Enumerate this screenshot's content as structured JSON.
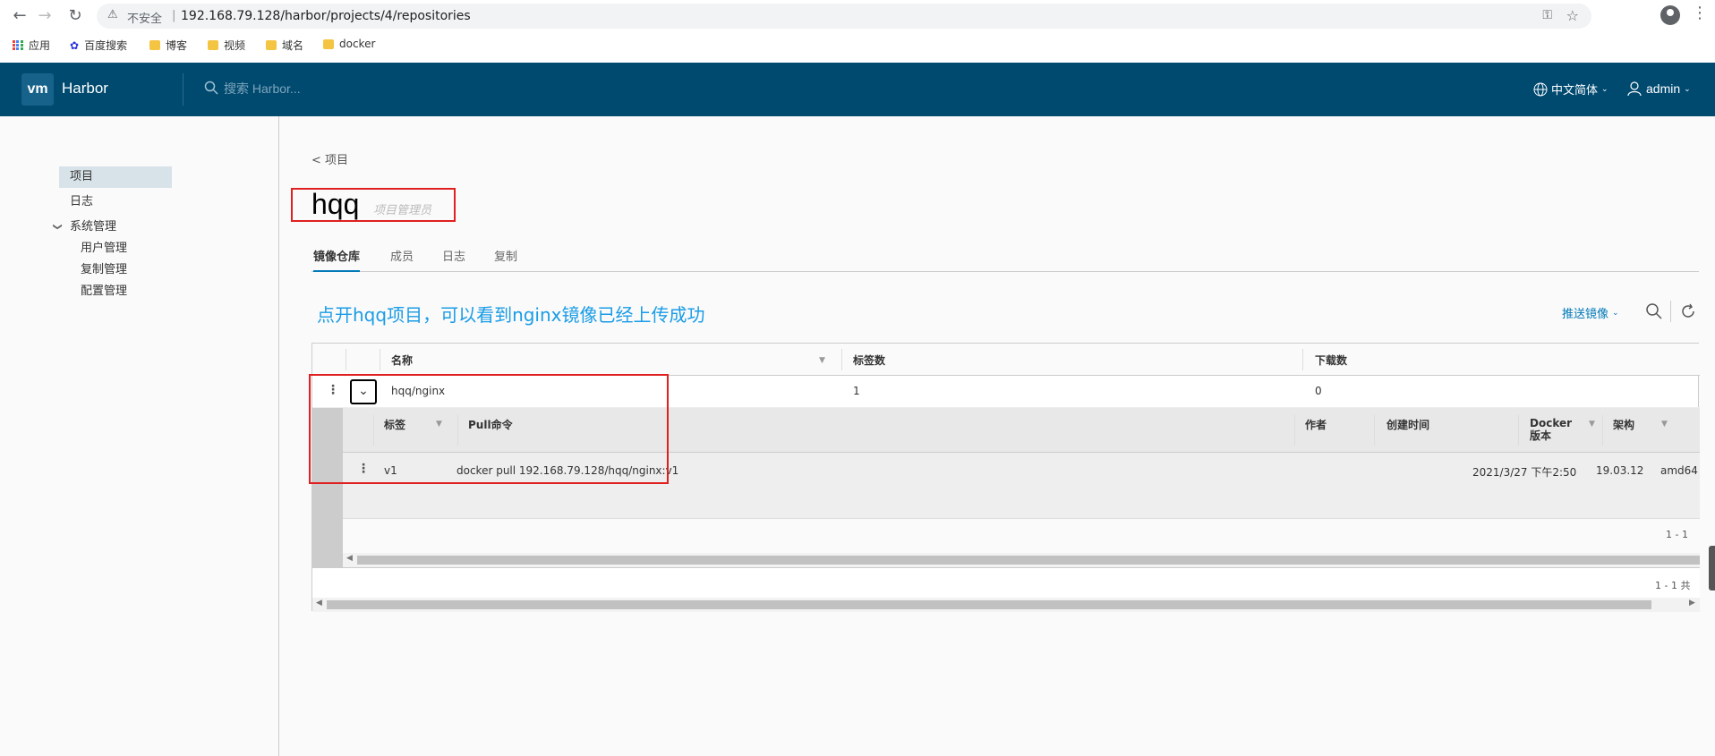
{
  "browser": {
    "insecure_label": "不安全",
    "url": "192.168.79.128/harbor/projects/4/repositories",
    "bookmarks": [
      {
        "label": "应用",
        "icon": "apps-grid-icon"
      },
      {
        "label": "百度搜索",
        "icon": "baidu-paw-icon"
      },
      {
        "label": "博客",
        "icon": "folder-icon"
      },
      {
        "label": "视频",
        "icon": "folder-icon"
      },
      {
        "label": "域名",
        "icon": "folder-icon"
      },
      {
        "label": "docker",
        "icon": "folder-icon"
      }
    ]
  },
  "header": {
    "logo": "vm",
    "app_name": "Harbor",
    "search_placeholder": "搜索 Harbor...",
    "language": "中文简体",
    "user": "admin"
  },
  "sidebar": {
    "items": [
      {
        "label": "项目",
        "active": true
      },
      {
        "label": "日志"
      },
      {
        "label": "系统管理"
      },
      {
        "label": "用户管理"
      },
      {
        "label": "复制管理"
      },
      {
        "label": "配置管理"
      }
    ]
  },
  "main": {
    "breadcrumb": "< 项目",
    "project_name": "hqq",
    "role": "项目管理员",
    "tabs": [
      {
        "label": "镜像仓库",
        "active": true
      },
      {
        "label": "成员"
      },
      {
        "label": "日志"
      },
      {
        "label": "复制"
      }
    ],
    "annotation": "点开hqq项目，可以看到nginx镜像已经上传成功",
    "push_image_label": "推送镜像",
    "columns": [
      "名称",
      "标签数",
      "下载数"
    ],
    "rows": [
      {
        "name": "hqq/nginx",
        "tags": "1",
        "pulls": "0"
      }
    ],
    "tag_columns": [
      "标签",
      "Pull命令",
      "作者",
      "创建时间",
      "Docker\n版本",
      "架构"
    ],
    "tag_rows": [
      {
        "tag": "v1",
        "pull": "docker pull 192.168.79.128/hqq/nginx:v1",
        "author": "",
        "created": "2021/3/27 下午2:50",
        "docker_version": "19.03.12",
        "arch": "amd64"
      }
    ],
    "nested_pagination": "1 - 1",
    "pagination": "1 - 1 共"
  }
}
